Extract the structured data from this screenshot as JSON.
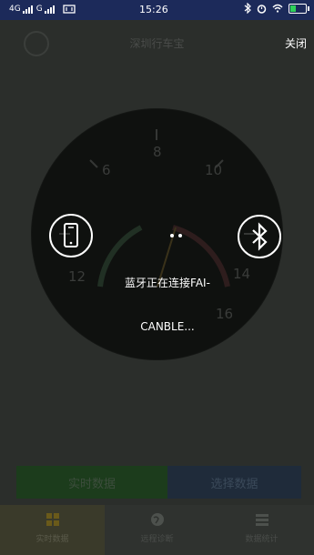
{
  "status_bar": {
    "network_left": "4G",
    "network_right": "G",
    "time": "15:26"
  },
  "header": {
    "title": "深圳行车宝",
    "close_label": "关闭"
  },
  "dial": {
    "numbers": [
      "6",
      "8",
      "10",
      "12",
      "14",
      "16"
    ]
  },
  "modal": {
    "message_line1": "蓝牙正在连接FAI-",
    "message_line2": "CANBLE..."
  },
  "actions": {
    "left_label": "实时数据",
    "right_label": "选择数据"
  },
  "tabs": [
    {
      "label": "实时数据"
    },
    {
      "label": "远程诊断"
    },
    {
      "label": "数据统计"
    }
  ],
  "colors": {
    "status_bar": "#1c2a5a",
    "background": "#2b2e2b",
    "modal_circle": "#0f110f",
    "accent_green": "#1c3c1c",
    "accent_blue": "#1f2b3a"
  }
}
